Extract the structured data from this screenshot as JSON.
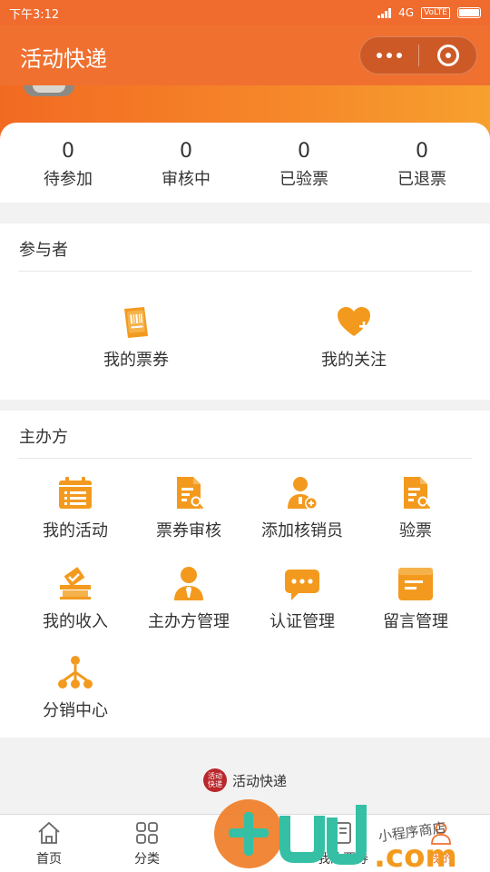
{
  "status_bar": {
    "time": "下午3:12",
    "network": "4G",
    "volte": "VoLTE"
  },
  "header": {
    "title": "活动快递"
  },
  "stats": [
    {
      "count": "0",
      "label": "待参加"
    },
    {
      "count": "0",
      "label": "审核中"
    },
    {
      "count": "0",
      "label": "已验票"
    },
    {
      "count": "0",
      "label": "已退票"
    }
  ],
  "participant": {
    "title": "参与者",
    "items": [
      {
        "label": "我的票券",
        "icon": "ticket-icon"
      },
      {
        "label": "我的关注",
        "icon": "heart-plus-icon"
      }
    ]
  },
  "organizer": {
    "title": "主办方",
    "items": [
      {
        "label": "我的活动",
        "icon": "calendar-icon"
      },
      {
        "label": "票券审核",
        "icon": "document-search-icon"
      },
      {
        "label": "添加核销员",
        "icon": "add-user-icon"
      },
      {
        "label": "验票",
        "icon": "document-search-icon"
      },
      {
        "label": "我的收入",
        "icon": "ballot-box-icon"
      },
      {
        "label": "主办方管理",
        "icon": "user-tie-icon"
      },
      {
        "label": "认证管理",
        "icon": "chat-bubble-icon"
      },
      {
        "label": "留言管理",
        "icon": "note-icon"
      },
      {
        "label": "分销中心",
        "icon": "hierarchy-icon"
      }
    ]
  },
  "footer": {
    "brand_name": "活动快递",
    "logo_text": "活动快递"
  },
  "tabbar": [
    {
      "label": "首页",
      "icon": "home-icon"
    },
    {
      "label": "分类",
      "icon": "grid-icon"
    },
    {
      "label": "",
      "icon": ""
    },
    {
      "label": "我的票券",
      "icon": "ticket-tab-icon"
    },
    {
      "label": "我的",
      "icon": "user-icon"
    }
  ],
  "colors": {
    "brand": "#f07030",
    "icon": "#f39a1e",
    "background": "#f2f2f2"
  },
  "watermark": {
    "text": "小程序商店",
    "domain": ".com"
  }
}
